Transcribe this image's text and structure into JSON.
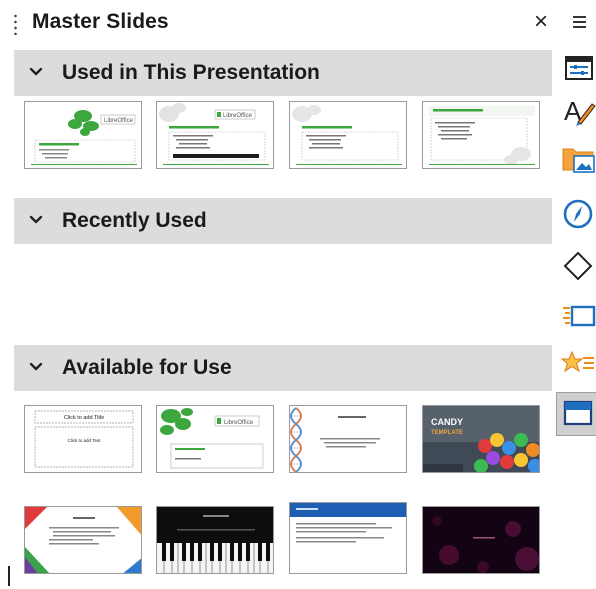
{
  "panel": {
    "title": "Master Slides",
    "close_glyph": "×"
  },
  "sections": {
    "used": {
      "label": "Used in This Presentation",
      "chevron": "chevron-down-icon"
    },
    "recent": {
      "label": "Recently Used",
      "chevron": "chevron-down-icon"
    },
    "available": {
      "label": "Available for Use",
      "chevron": "chevron-down-icon"
    }
  },
  "used_thumbnails": [
    {
      "name": "libreoffice-green-leaf-title",
      "logo_text": "LibreOffice"
    },
    {
      "name": "libreoffice-green-leaf-content",
      "logo_text": "LibreOffice"
    },
    {
      "name": "libreoffice-green-plain-content"
    },
    {
      "name": "libreoffice-green-notes"
    }
  ],
  "available_thumbnails": [
    {
      "name": "default-blank",
      "title_text": "Click to add Title",
      "body_text": "Click to add Text"
    },
    {
      "name": "libreoffice-green-leaf",
      "logo_text": "LibreOffice"
    },
    {
      "name": "dna-helix"
    },
    {
      "name": "candy",
      "title_text": "CANDY",
      "subtitle_text": "TEMPLATE"
    },
    {
      "name": "colored-corners"
    },
    {
      "name": "piano-keys"
    },
    {
      "name": "blue-header"
    },
    {
      "name": "dark-bokeh"
    }
  ],
  "tabbar": {
    "tabs": [
      {
        "icon": "hamburger-menu-icon"
      },
      {
        "icon": "properties-icon"
      },
      {
        "icon": "styles-icon"
      },
      {
        "icon": "gallery-icon"
      },
      {
        "icon": "navigator-icon"
      },
      {
        "icon": "shapes-icon"
      },
      {
        "icon": "slide-transition-icon"
      },
      {
        "icon": "animation-icon"
      },
      {
        "icon": "master-slides-icon",
        "active": true
      }
    ]
  },
  "colors": {
    "section_bg": "#dcdcdc",
    "lo_green": "#36a53a",
    "tab_active_bg": "#cfcfcf",
    "icon_blue": "#1e6fc0",
    "icon_orange": "#f08c1a"
  }
}
